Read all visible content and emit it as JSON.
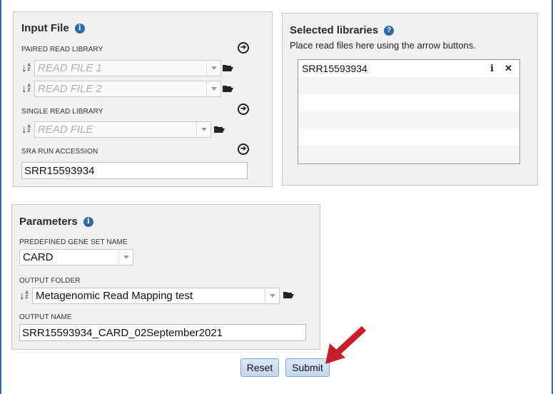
{
  "input_file": {
    "title": "Input File",
    "paired_label": "PAIRED READ LIBRARY",
    "read1_placeholder": "READ FILE 1",
    "read2_placeholder": "READ FILE 2",
    "single_label": "SINGLE READ LIBRARY",
    "single_placeholder": "READ FILE",
    "sra_label": "SRA RUN ACCESSION",
    "sra_value": "SRR15593934"
  },
  "selected_libraries": {
    "title": "Selected libraries",
    "help": "Place read files here using the arrow buttons.",
    "rows": [
      {
        "name": "SRR15593934"
      }
    ]
  },
  "parameters": {
    "title": "Parameters",
    "gene_set_label": "PREDEFINED GENE SET NAME",
    "gene_set_value": "CARD",
    "output_folder_label": "OUTPUT FOLDER",
    "output_folder_value": "Metagenomic Read Mapping test",
    "output_name_label": "OUTPUT NAME",
    "output_name_value": "SRR15593934_CARD_02September2021"
  },
  "actions": {
    "reset_label": "Reset",
    "submit_label": "Submit"
  },
  "colors": {
    "panel_bg": "#f1f1f1",
    "info_icon": "#2e6aa6",
    "button_bg": "#c4d7ee",
    "annotation_arrow": "#c81e2a"
  },
  "icons": [
    "info-icon",
    "help-icon",
    "arrow-right-circle-icon",
    "sort-az-icon",
    "folder-open-icon",
    "chevron-down-icon",
    "close-icon"
  ]
}
